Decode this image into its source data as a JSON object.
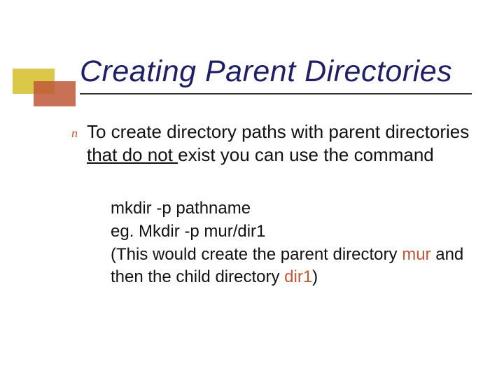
{
  "title": "Creating Parent Directories",
  "bullet_marker": "n",
  "body": {
    "pre": "To create directory paths with parent directories ",
    "underlined": "that do not ",
    "post": "exist you can use the command"
  },
  "sub": {
    "line1": "mkdir -p pathname",
    "line2": "eg. Mkdir -p mur/dir1",
    "line3_pre": "(This would create the parent directory ",
    "line3_red": "mur",
    "line4_pre": " and then the child directory ",
    "line4_red": "dir1",
    "line4_post": ")"
  }
}
